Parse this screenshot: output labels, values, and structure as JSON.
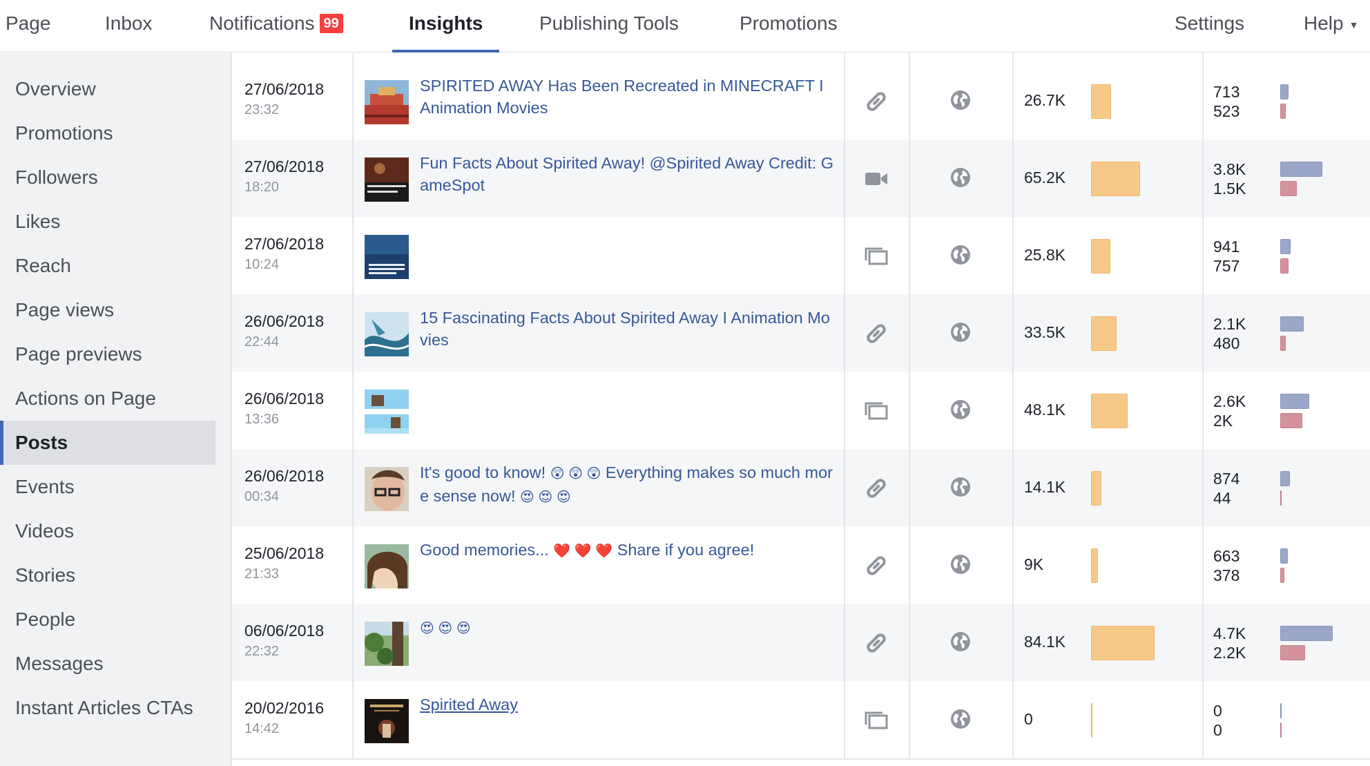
{
  "nav": {
    "tabs": [
      {
        "label": "Page"
      },
      {
        "label": "Inbox"
      },
      {
        "label": "Notifications",
        "badge": "99"
      },
      {
        "label": "Insights",
        "active": true
      },
      {
        "label": "Publishing Tools"
      },
      {
        "label": "Promotions"
      },
      {
        "label": "Settings"
      },
      {
        "label": "Help"
      }
    ]
  },
  "sidebar": {
    "items": [
      {
        "label": "Overview"
      },
      {
        "label": "Promotions"
      },
      {
        "label": "Followers"
      },
      {
        "label": "Likes"
      },
      {
        "label": "Reach"
      },
      {
        "label": "Page views"
      },
      {
        "label": "Page previews"
      },
      {
        "label": "Actions on Page"
      },
      {
        "label": "Posts",
        "active": true
      },
      {
        "label": "Events"
      },
      {
        "label": "Videos"
      },
      {
        "label": "Stories"
      },
      {
        "label": "People"
      },
      {
        "label": "Messages"
      },
      {
        "label": "Instant Articles CTAs"
      }
    ]
  },
  "colors": {
    "accent": "#4267b2",
    "link": "#365899",
    "reach_bar": "#f7c989",
    "engagement_bar_1": "#9aa7c9",
    "engagement_bar_2": "#d5929c",
    "badge": "#fa3e3e"
  },
  "posts": [
    {
      "date": "27/06/2018",
      "time": "23:32",
      "text": "SPIRITED AWAY Has Been Recreated in MINECRAFT I Animation Movies",
      "type_icon": "link-icon",
      "privacy_icon": "globe-icon",
      "reach": "26.7K",
      "reach_value": 26.7,
      "eng1": "713",
      "eng2": "523",
      "eng1_value": 713,
      "eng2_value": 523,
      "thumb": "temple"
    },
    {
      "date": "27/06/2018",
      "time": "18:20",
      "text": "Fun Facts About Spirited Away! @Spirited Away Credit: GameSpot",
      "type_icon": "video-icon",
      "privacy_icon": "globe-icon",
      "reach": "65.2K",
      "reach_value": 65.2,
      "eng1": "3.8K",
      "eng2": "1.5K",
      "eng1_value": 3800,
      "eng2_value": 1500,
      "thumb": "video"
    },
    {
      "date": "27/06/2018",
      "time": "10:24",
      "text": "",
      "type_icon": "photo-icon",
      "privacy_icon": "globe-icon",
      "reach": "25.8K",
      "reach_value": 25.8,
      "eng1": "941",
      "eng2": "757",
      "eng1_value": 941,
      "eng2_value": 757,
      "thumb": "ocean"
    },
    {
      "date": "26/06/2018",
      "time": "22:44",
      "text": "15 Fascinating Facts About Spirited Away I Animation Movies",
      "type_icon": "link-icon",
      "privacy_icon": "globe-icon",
      "reach": "33.5K",
      "reach_value": 33.5,
      "eng1": "2.1K",
      "eng2": "480",
      "eng1_value": 2100,
      "eng2_value": 480,
      "thumb": "dragon"
    },
    {
      "date": "26/06/2018",
      "time": "13:36",
      "text": "",
      "type_icon": "photo-icon",
      "privacy_icon": "globe-icon",
      "reach": "48.1K",
      "reach_value": 48.1,
      "eng1": "2.6K",
      "eng2": "2K",
      "eng1_value": 2600,
      "eng2_value": 2000,
      "thumb": "sky"
    },
    {
      "date": "26/06/2018",
      "time": "00:34",
      "text_parts": [
        "It's good to know! ",
        "😲 😲 😲",
        "  Everything makes so much more sense now! ",
        "😍 😍 😍"
      ],
      "type_icon": "link-icon",
      "privacy_icon": "globe-icon",
      "reach": "14.1K",
      "reach_value": 14.1,
      "eng1": "874",
      "eng2": "44",
      "eng1_value": 874,
      "eng2_value": 44,
      "thumb": "face"
    },
    {
      "date": "25/06/2018",
      "time": "21:33",
      "text_parts": [
        "Good memories... ",
        "❤️ ❤️ ❤️",
        "  Share if you agree!"
      ],
      "type_icon": "link-icon",
      "privacy_icon": "globe-icon",
      "reach": "9K",
      "reach_value": 9,
      "eng1": "663",
      "eng2": "378",
      "eng1_value": 663,
      "eng2_value": 378,
      "thumb": "girl"
    },
    {
      "date": "06/06/2018",
      "time": "22:32",
      "text_parts": [
        "",
        "😍 😍 😍",
        ""
      ],
      "type_icon": "link-icon",
      "privacy_icon": "globe-icon",
      "reach": "84.1K",
      "reach_value": 84.1,
      "eng1": "4.7K",
      "eng2": "2.2K",
      "eng1_value": 4700,
      "eng2_value": 2200,
      "thumb": "forest"
    },
    {
      "date": "20/02/2016",
      "time": "14:42",
      "text": "Spirited Away",
      "underline": true,
      "type_icon": "photo-icon",
      "privacy_icon": "globe-icon",
      "reach": "0",
      "reach_value": 0,
      "eng1": "0",
      "eng2": "0",
      "eng1_value": 0,
      "eng2_value": 0,
      "thumb": "poster"
    }
  ]
}
